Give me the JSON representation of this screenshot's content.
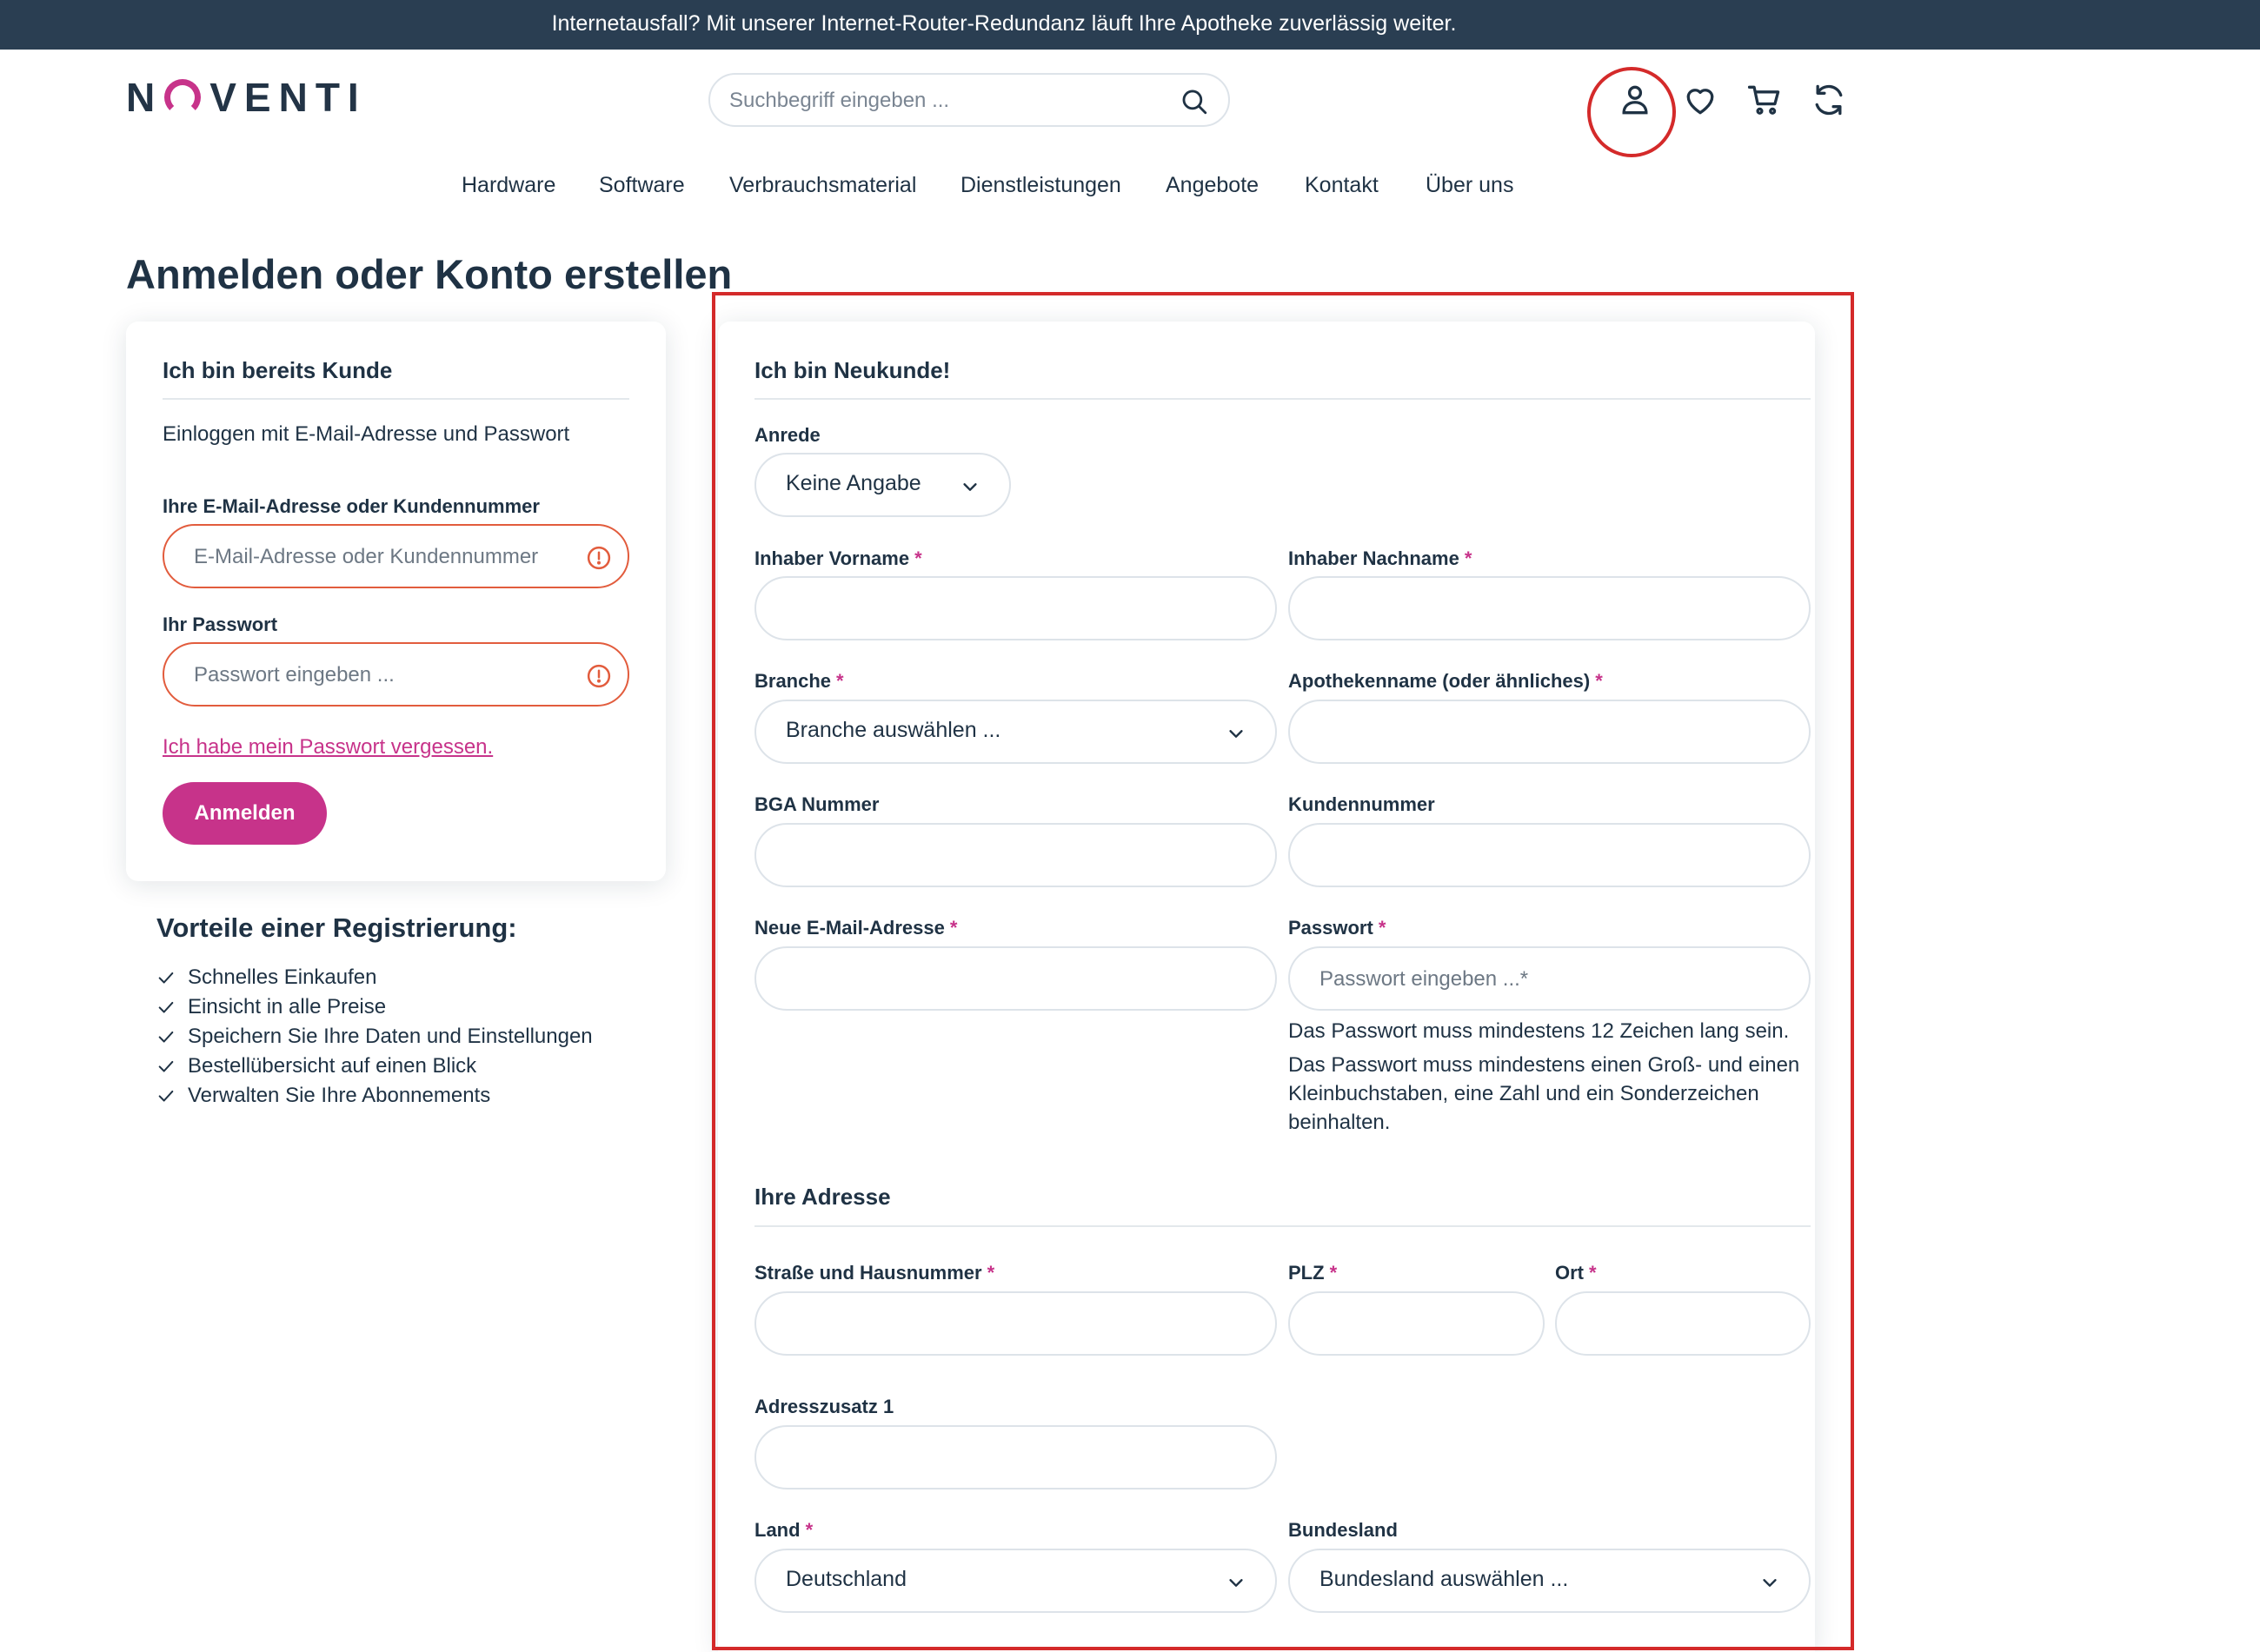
{
  "topbar": {
    "text": "Internetausfall? Mit unserer Internet-Router-Redundanz läuft Ihre Apotheke zuverlässig weiter."
  },
  "header": {
    "logo_text": "NOVENTI",
    "search_placeholder": "Suchbegriff eingeben ...",
    "icons": [
      "search-icon",
      "account-icon",
      "heart-icon",
      "cart-icon",
      "refresh-icon"
    ]
  },
  "nav": {
    "items": [
      "Hardware",
      "Software",
      "Verbrauchsmaterial",
      "Dienstleistungen",
      "Angebote",
      "Kontakt",
      "Über uns"
    ]
  },
  "page": {
    "title": "Anmelden oder Konto erstellen"
  },
  "login": {
    "title": "Ich bin bereits Kunde",
    "subtitle": "Einloggen mit E-Mail-Adresse und Passwort",
    "email_label": "Ihre E-Mail-Adresse oder Kundennummer",
    "email_placeholder": "E-Mail-Adresse oder Kundennummer",
    "password_label": "Ihr Passwort",
    "password_placeholder": "Passwort eingeben ...",
    "forgot": "Ich habe mein Passwort vergessen.",
    "submit": "Anmelden"
  },
  "benefits": {
    "title": "Vorteile einer Registrierung:",
    "items": [
      "Schnelles Einkaufen",
      "Einsicht in alle Preise",
      "Speichern Sie Ihre Daten und Einstellungen",
      "Bestellübersicht auf einen Blick",
      "Verwalten Sie Ihre Abonnements"
    ]
  },
  "register": {
    "title": "Ich bin Neukunde!",
    "required_mark": "*",
    "salutation_label": "Anrede",
    "salutation_value": "Keine Angabe",
    "first_name_label": "Inhaber Vorname",
    "last_name_label": "Inhaber Nachname",
    "branch_label": "Branche",
    "branch_value": "Branche auswählen ...",
    "pharmacy_label": "Apothekenname (oder ähnliches)",
    "bga_label": "BGA Nummer",
    "customer_no_label": "Kundennummer",
    "email_label": "Neue E-Mail-Adresse",
    "password_label": "Passwort",
    "password_placeholder": "Passwort eingeben ...*",
    "password_hint_1": "Das Passwort muss mindestens 12 Zeichen lang sein.",
    "password_hint_2": "Das Passwort muss mindestens einen Groß- und einen Kleinbuchstaben, eine Zahl und ein Sonderzeichen beinhalten."
  },
  "address": {
    "title": "Ihre Adresse",
    "street_label": "Straße und Hausnummer",
    "zip_label": "PLZ",
    "city_label": "Ort",
    "extra_label": "Adresszusatz 1",
    "country_label": "Land",
    "country_value": "Deutschland",
    "state_label": "Bundesland",
    "state_value": "Bundesland auswählen ..."
  },
  "colors": {
    "brand_magenta": "#c7338a",
    "dark_navy": "#2a3e52",
    "error": "#e25c3d",
    "highlight": "#d42a2a"
  }
}
